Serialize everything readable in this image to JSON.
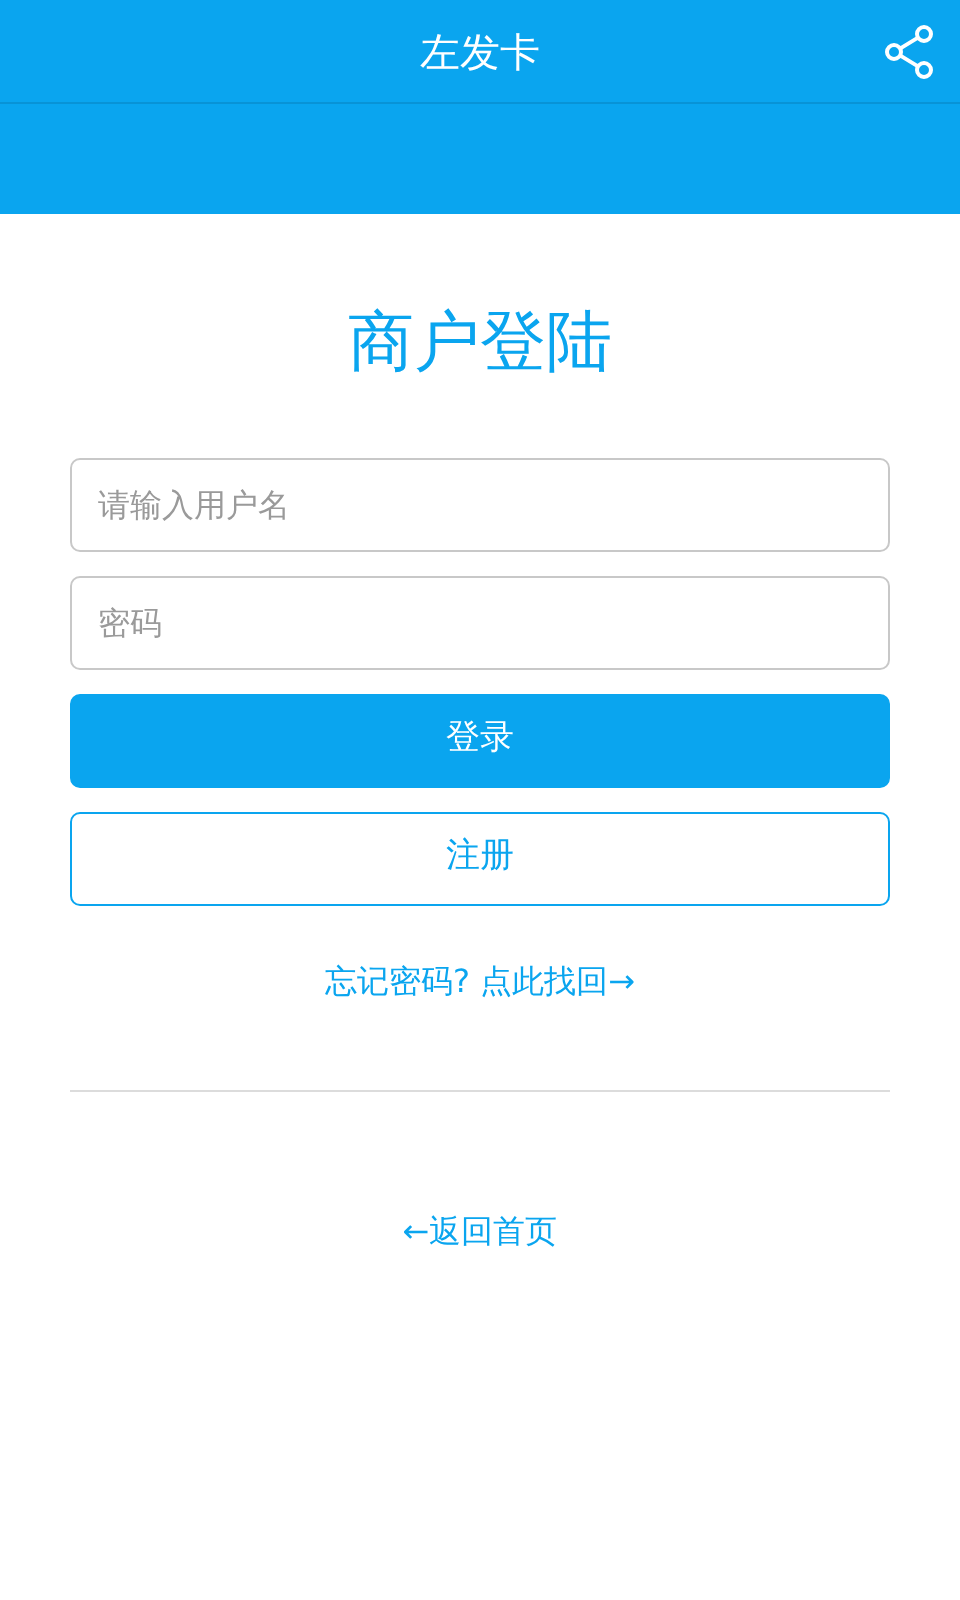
{
  "header": {
    "title": "左发卡"
  },
  "page_title": "商户登陆",
  "fields": [
    {
      "placeholder": "请输入用户名"
    },
    {
      "placeholder": "密码"
    }
  ],
  "buttons": [
    {
      "label": "登录",
      "kind": "primary"
    },
    {
      "label": "注册",
      "kind": "outline"
    }
  ],
  "forgot_link": "忘记密码? 点此找回→",
  "back_link": "←返回首页"
}
